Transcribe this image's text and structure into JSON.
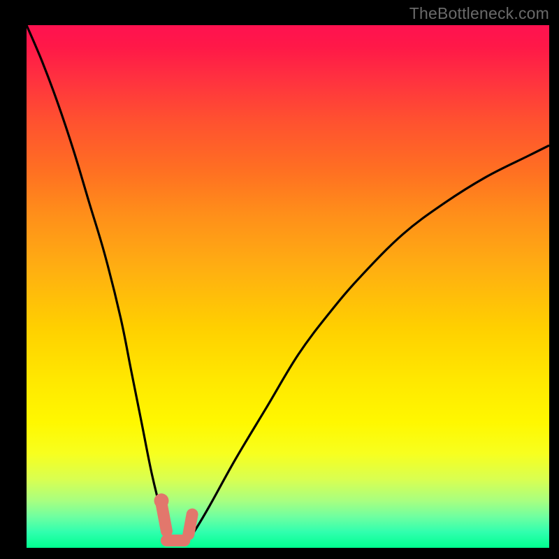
{
  "watermark": "TheBottleneck.com",
  "chart_data": {
    "type": "line",
    "title": "",
    "xlabel": "",
    "ylabel": "",
    "xlim": [
      0,
      100
    ],
    "ylim": [
      0,
      100
    ],
    "grid": false,
    "legend": false,
    "series": [
      {
        "name": "bottleneck-curve",
        "x": [
          0,
          3,
          6,
          9,
          12,
          15,
          18,
          20,
          22,
          24,
          26,
          27,
          27.8,
          29,
          30.5,
          32,
          35,
          40,
          46,
          52,
          58,
          64,
          72,
          80,
          88,
          96,
          100
        ],
        "values": [
          100,
          93,
          85,
          76,
          66,
          56,
          44,
          34,
          24,
          14,
          6,
          3,
          1,
          1,
          1.2,
          3,
          8,
          17,
          27,
          37,
          45,
          52,
          60,
          66,
          71,
          75,
          77
        ]
      }
    ],
    "marker": {
      "name": "optimal-range",
      "segments": [
        {
          "x0": 25.8,
          "y0": 8.5,
          "x1": 26.8,
          "y1": 3.2
        },
        {
          "x0": 26.8,
          "y0": 1.4,
          "x1": 30.2,
          "y1": 1.4
        },
        {
          "x0": 31.0,
          "y0": 2.6,
          "x1": 31.7,
          "y1": 6.4
        }
      ],
      "dot": {
        "x": 25.8,
        "y": 9.0
      }
    },
    "background_gradient": {
      "top": "#ff1250",
      "mid": "#ffe000",
      "bottom": "#00ff90"
    }
  }
}
